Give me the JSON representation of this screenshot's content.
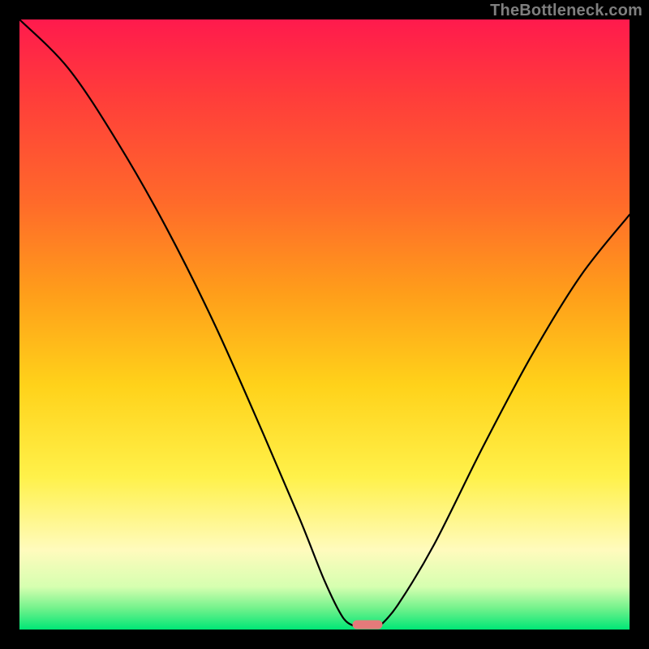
{
  "watermark": "TheBottleneck.com",
  "chart_data": {
    "type": "line",
    "title": "",
    "xlabel": "",
    "ylabel": "",
    "xlim": [
      0,
      100
    ],
    "ylim": [
      0,
      100
    ],
    "grid": false,
    "curve_left": [
      {
        "x": 0,
        "y": 100
      },
      {
        "x": 8,
        "y": 92
      },
      {
        "x": 16,
        "y": 80
      },
      {
        "x": 24,
        "y": 66
      },
      {
        "x": 32,
        "y": 50
      },
      {
        "x": 40,
        "y": 32
      },
      {
        "x": 46,
        "y": 18
      },
      {
        "x": 50,
        "y": 8
      },
      {
        "x": 53,
        "y": 2
      },
      {
        "x": 55,
        "y": 0.5
      }
    ],
    "curve_right": [
      {
        "x": 59,
        "y": 0.5
      },
      {
        "x": 62,
        "y": 4
      },
      {
        "x": 68,
        "y": 14
      },
      {
        "x": 76,
        "y": 30
      },
      {
        "x": 84,
        "y": 45
      },
      {
        "x": 92,
        "y": 58
      },
      {
        "x": 100,
        "y": 68
      }
    ],
    "optimal_point": {
      "x": 57,
      "y": 0.8
    },
    "background": "red-yellow-green vertical gradient"
  }
}
